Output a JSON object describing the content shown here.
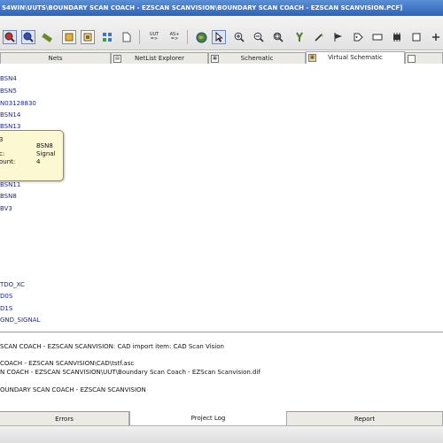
{
  "window": {
    "title": "S4WIN\\UUTS\\BOUNDARY SCAN COACH - EZSCAN SCANVISION\\BOUNDARY SCAN COACH - EZSCAN SCANVISION.PCF]"
  },
  "toolbar": {
    "icons": [
      "view-red-icon",
      "view-blue-icon",
      "ruler-icon",
      "panel-yellow-icon",
      "image-frame-icon",
      "grid-icon",
      "page-icon",
      "uut-button",
      "asi-button",
      "globe-icon",
      "pointer-icon",
      "zoom-in-icon",
      "zoom-out-icon",
      "zoom-fit-icon",
      "probe-icon",
      "wand-icon",
      "flag-icon",
      "tag-icon",
      "rectangle-icon",
      "chip-icon",
      "box-icon"
    ],
    "uut_label": [
      "UUT",
      "=>"
    ],
    "asi_label": [
      "AS+",
      "=>"
    ]
  },
  "tabs": [
    {
      "label": "Nets"
    },
    {
      "label": "NetList Explorer"
    },
    {
      "label": "Schematic"
    },
    {
      "label": "Virtual Schematic",
      "active": true
    },
    {
      "label": ""
    }
  ],
  "tree": {
    "nodes": [
      "BSN4",
      "BSN5",
      "N03128830",
      "BSN14",
      "BSN13",
      "BSN11",
      "BSN8",
      "BV3",
      "TDO_XC",
      "D0S",
      "D1S",
      "GND_SIGNAL"
    ]
  },
  "tooltip": {
    "rows": [
      {
        "key": "3",
        "value": ""
      },
      {
        "key": "",
        "value": "BSN8"
      },
      {
        "key": "c:",
        "value": "Signal"
      },
      {
        "key": "ount:",
        "value": "4"
      }
    ]
  },
  "log": {
    "lines": [
      "SCAN COACH - EZSCAN SCANVISION: CAD import item: CAD Scan Vision",
      "COACH - EZSCAN SCANVISION\\CAD\\tstf.asc",
      "N COACH - EZSCAN SCANVISION\\UUT\\Boundary Scan Coach - EZScan Scanvision.dif",
      "OUNDARY SCAN COACH - EZSCAN SCANVISION"
    ]
  },
  "bottom_tabs": [
    {
      "label": "Errors"
    },
    {
      "label": "Project Log",
      "active": true
    },
    {
      "label": "Report"
    }
  ]
}
